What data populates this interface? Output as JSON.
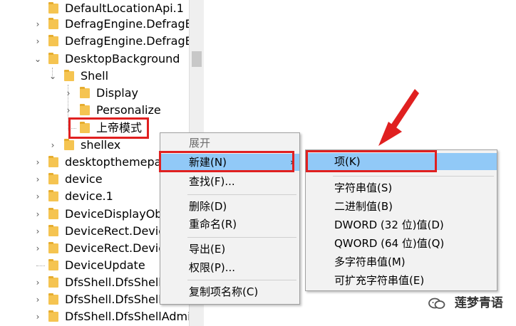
{
  "tree": {
    "items": [
      {
        "label": "DefaultLocationApi.1",
        "arrow": ""
      },
      {
        "label": "DefragEngine.DefragE",
        "arrow": "›"
      },
      {
        "label": "DefragEngine.DefragE",
        "arrow": "›"
      },
      {
        "label": "DesktopBackground",
        "arrow": "⌄"
      },
      {
        "label": "Shell",
        "arrow": "⌄"
      },
      {
        "label": "Display",
        "arrow": "›"
      },
      {
        "label": "Personalize",
        "arrow": "›"
      },
      {
        "label": "上帝模式",
        "arrow": ""
      },
      {
        "label": "shellex",
        "arrow": "›"
      },
      {
        "label": "desktopthemepa",
        "arrow": "›"
      },
      {
        "label": "device",
        "arrow": "›"
      },
      {
        "label": "device.1",
        "arrow": "›"
      },
      {
        "label": "DeviceDisplayOb",
        "arrow": "›"
      },
      {
        "label": "DeviceRect.Devic",
        "arrow": "›"
      },
      {
        "label": "DeviceRect.Devic",
        "arrow": "›"
      },
      {
        "label": "DeviceUpdate",
        "arrow": ""
      },
      {
        "label": "DfsShell.DfsShell",
        "arrow": "›"
      },
      {
        "label": "DfsShell.DfsShell.",
        "arrow": "›"
      },
      {
        "label": "DfsShell.DfsShellAdmi",
        "arrow": "›"
      }
    ]
  },
  "context_menu": {
    "header": "展开",
    "new_label": "新建(N)",
    "find_label": "查找(F)...",
    "delete_label": "删除(D)",
    "rename_label": "重命名(R)",
    "export_label": "导出(E)",
    "permissions_label": "权限(P)...",
    "copy_key_name_label": "复制项名称(C)",
    "submenu_arrow": "›"
  },
  "submenu": {
    "key_label": "项(K)",
    "string_value_label": "字符串值(S)",
    "binary_value_label": "二进制值(B)",
    "dword_label": "DWORD (32 位)值(D)",
    "qword_label": "QWORD (64 位)值(Q)",
    "multi_string_label": "多字符串值(M)",
    "expandable_string_label": "可扩充字符串值(E)"
  },
  "watermark": {
    "text": "莲梦青语"
  },
  "colors": {
    "highlight_red": "#e02020",
    "menu_highlight": "#91c9f7",
    "menu_background": "#f2f2f2",
    "folder": "#f5c451"
  }
}
